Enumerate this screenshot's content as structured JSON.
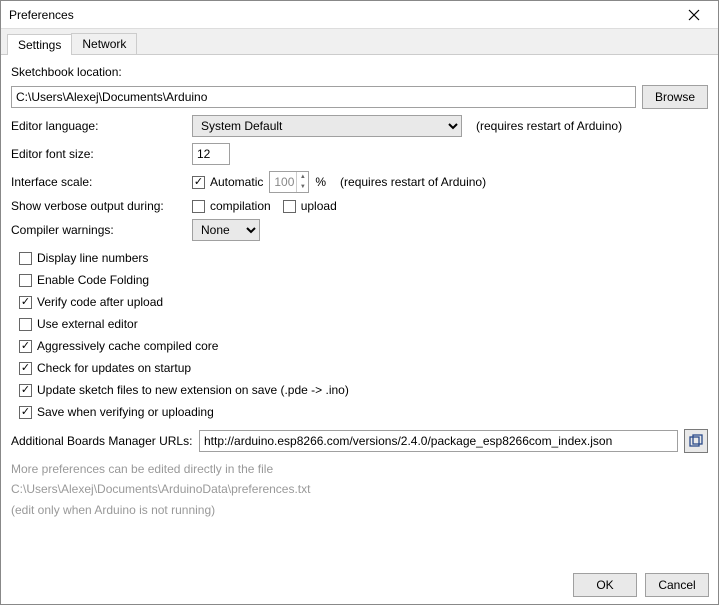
{
  "window": {
    "title": "Preferences"
  },
  "tabs": {
    "settings": "Settings",
    "network": "Network"
  },
  "labels": {
    "sketchbook": "Sketchbook location:",
    "browse": "Browse",
    "editor_lang": "Editor language:",
    "restart_hint": "(requires restart of Arduino)",
    "font_size": "Editor font size:",
    "interface_scale": "Interface scale:",
    "automatic": "Automatic",
    "percent": "%",
    "verbose": "Show verbose output during:",
    "compilation": "compilation",
    "upload": "upload",
    "compiler_warnings": "Compiler warnings:",
    "boards_urls": "Additional Boards Manager URLs:",
    "more_prefs": "More preferences can be edited directly in the file",
    "edit_only": "(edit only when Arduino is not running)",
    "ok": "OK",
    "cancel": "Cancel"
  },
  "values": {
    "sketchbook_path": "C:\\Users\\Alexej\\Documents\\Arduino",
    "language": "System Default",
    "font_size": "12",
    "scale": "100",
    "compiler_warnings": "None",
    "boards_url": "http://arduino.esp8266.com/versions/2.4.0/package_esp8266com_index.json",
    "prefs_path": "C:\\Users\\Alexej\\Documents\\ArduinoData\\preferences.txt"
  },
  "options": {
    "display_line_numbers": {
      "label": "Display line numbers",
      "checked": false
    },
    "enable_code_folding": {
      "label": "Enable Code Folding",
      "checked": false
    },
    "verify_after_upload": {
      "label": "Verify code after upload",
      "checked": true
    },
    "use_external_editor": {
      "label": "Use external editor",
      "checked": false
    },
    "cache_core": {
      "label": "Aggressively cache compiled core",
      "checked": true
    },
    "check_updates": {
      "label": "Check for updates on startup",
      "checked": true
    },
    "update_extension": {
      "label": "Update sketch files to new extension on save (.pde -> .ino)",
      "checked": true
    },
    "save_on_verify": {
      "label": "Save when verifying or uploading",
      "checked": true
    }
  },
  "state": {
    "automatic_checked": true,
    "compilation_checked": false,
    "upload_checked": false
  }
}
